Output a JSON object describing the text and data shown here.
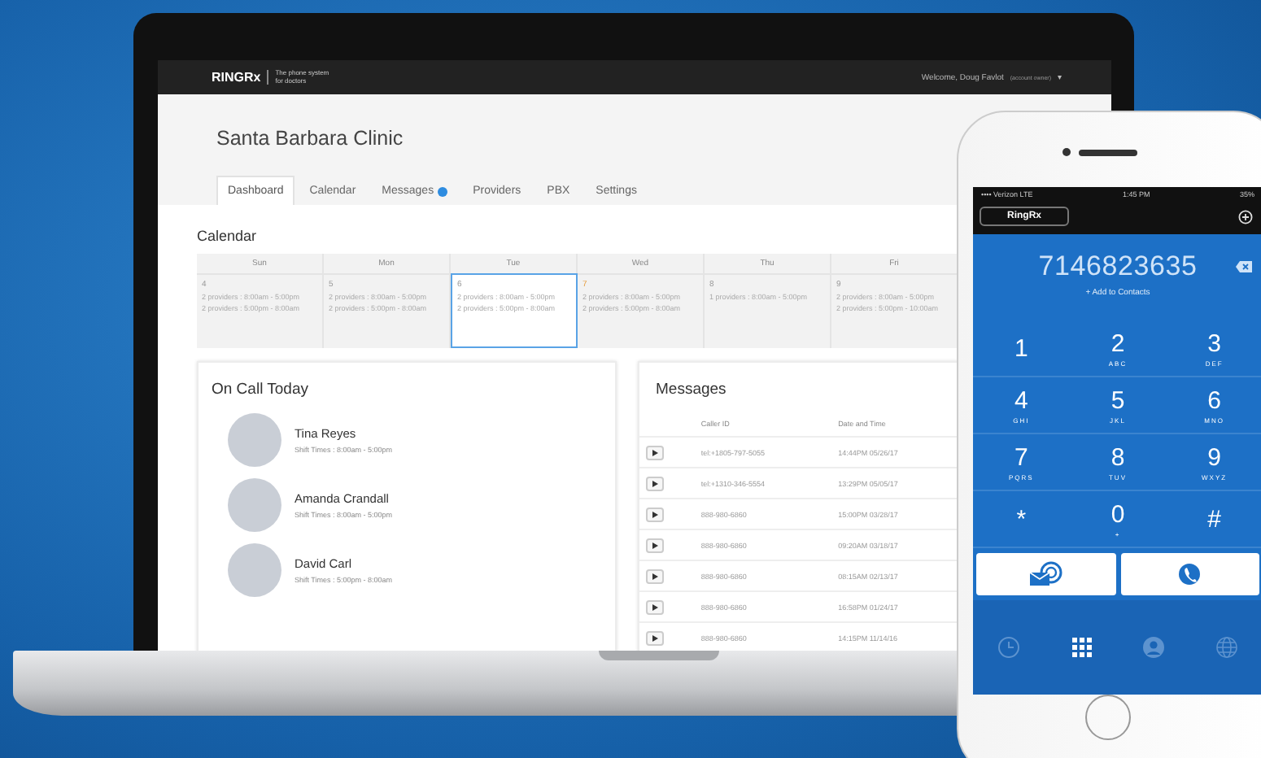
{
  "laptop": {
    "header": {
      "logo": "RINGRx",
      "tagline": "The phone system for doctors",
      "welcome": "Welcome, Doug Favlot",
      "account_note": "(account owner)",
      "caret": "▾"
    },
    "clinic_title": "Santa Barbara Clinic",
    "tabs": [
      {
        "label": "Dashboard",
        "selected": true,
        "badge": false
      },
      {
        "label": "Calendar",
        "selected": false,
        "badge": false
      },
      {
        "label": "Messages",
        "selected": false,
        "badge": true
      },
      {
        "label": "Providers",
        "selected": false,
        "badge": false
      },
      {
        "label": "PBX",
        "selected": false,
        "badge": false
      },
      {
        "label": "Settings",
        "selected": false,
        "badge": false
      }
    ],
    "calendar": {
      "title": "Calendar",
      "days": [
        {
          "name": "Sun",
          "date": "4",
          "selected": false,
          "today": false,
          "entries": [
            "2 providers : 8:00am - 5:00pm",
            "2 providers : 5:00pm - 8:00am"
          ]
        },
        {
          "name": "Mon",
          "date": "5",
          "selected": false,
          "today": false,
          "entries": [
            "2 providers : 8:00am - 5:00pm",
            "2 providers : 5:00pm - 8:00am"
          ]
        },
        {
          "name": "Tue",
          "date": "6",
          "selected": true,
          "today": false,
          "entries": [
            "2 providers : 8:00am - 5:00pm",
            "2 providers : 5:00pm - 8:00am"
          ]
        },
        {
          "name": "Wed",
          "date": "7",
          "selected": false,
          "today": true,
          "entries": [
            "2 providers : 8:00am - 5:00pm",
            "2 providers : 5:00pm - 8:00am"
          ]
        },
        {
          "name": "Thu",
          "date": "8",
          "selected": false,
          "today": false,
          "entries": [
            "1 providers : 8:00am - 5:00pm"
          ]
        },
        {
          "name": "Fri",
          "date": "9",
          "selected": false,
          "today": false,
          "entries": [
            "2 providers : 8:00am - 5:00pm",
            "2 providers : 5:00pm - 10:00am"
          ]
        }
      ]
    },
    "on_call": {
      "title": "On Call Today",
      "people": [
        {
          "name": "Tina Reyes",
          "shift": "Shift Times : 8:00am - 5:00pm"
        },
        {
          "name": "Amanda Crandall",
          "shift": "Shift Times : 8:00am - 5:00pm"
        },
        {
          "name": "David Carl",
          "shift": "Shift Times : 5:00pm - 8:00am"
        }
      ]
    },
    "messages": {
      "title": "Messages",
      "columns": [
        "Caller ID",
        "Date and Time"
      ],
      "rows": [
        {
          "caller": "tel:+1805-797-5055",
          "time": "14:44PM 05/26/17"
        },
        {
          "caller": "tel:+1310-346-5554",
          "time": "13:29PM 05/05/17"
        },
        {
          "caller": "888-980-6860",
          "time": "15:00PM 03/28/17"
        },
        {
          "caller": "888-980-6860",
          "time": "09:20AM 03/18/17"
        },
        {
          "caller": "888-980-6860",
          "time": "08:15AM 02/13/17"
        },
        {
          "caller": "888-980-6860",
          "time": "16:58PM 01/24/17"
        },
        {
          "caller": "888-980-6860",
          "time": "14:15PM 11/14/16"
        }
      ]
    }
  },
  "phone": {
    "status": {
      "carrier": "•••• Verizon LTE",
      "time": "1:45 PM",
      "battery": "35%"
    },
    "account_button": "RingRx",
    "number": "7146823635",
    "add_contact": "+ Add to Contacts",
    "keys": [
      {
        "digit": "1"
      },
      {
        "digit": "2",
        "letters": "ABC"
      },
      {
        "digit": "3",
        "letters": "DEF"
      },
      {
        "digit": "4",
        "letters": "GHI"
      },
      {
        "digit": "5",
        "letters": "JKL"
      },
      {
        "digit": "6",
        "letters": "MNO"
      },
      {
        "digit": "7",
        "letters": "PQRS"
      },
      {
        "digit": "8",
        "letters": "TUV"
      },
      {
        "digit": "9",
        "letters": "WXYZ"
      },
      {
        "digit": "*"
      },
      {
        "digit": "0",
        "letters": "+"
      },
      {
        "digit": "#"
      }
    ],
    "tabs": [
      {
        "kind": "clock",
        "selected": false
      },
      {
        "kind": "keypad",
        "selected": true
      },
      {
        "kind": "contact",
        "selected": false
      },
      {
        "kind": "globe",
        "selected": false
      }
    ]
  }
}
